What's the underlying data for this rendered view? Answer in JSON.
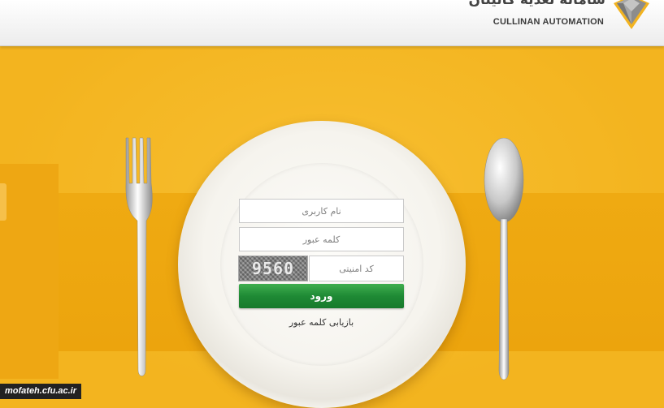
{
  "header": {
    "title_fa": "سامانه تغذیه کالینان",
    "subtitle": "CULLINAN AUTOMATION",
    "logo_icon": "diamond-icon"
  },
  "login": {
    "username_placeholder": "نام کاربری",
    "password_placeholder": "کلمه عبور",
    "captcha_placeholder": "کد امنیتی",
    "captcha_code": "9560",
    "submit_label": "ورود",
    "recover_label": "بازیابی کلمه عبور"
  },
  "watermark": "mofateh.cfu.ac.ir",
  "colors": {
    "table": "#f3b41f",
    "button": "#1f8a35",
    "header": "#efefef"
  }
}
